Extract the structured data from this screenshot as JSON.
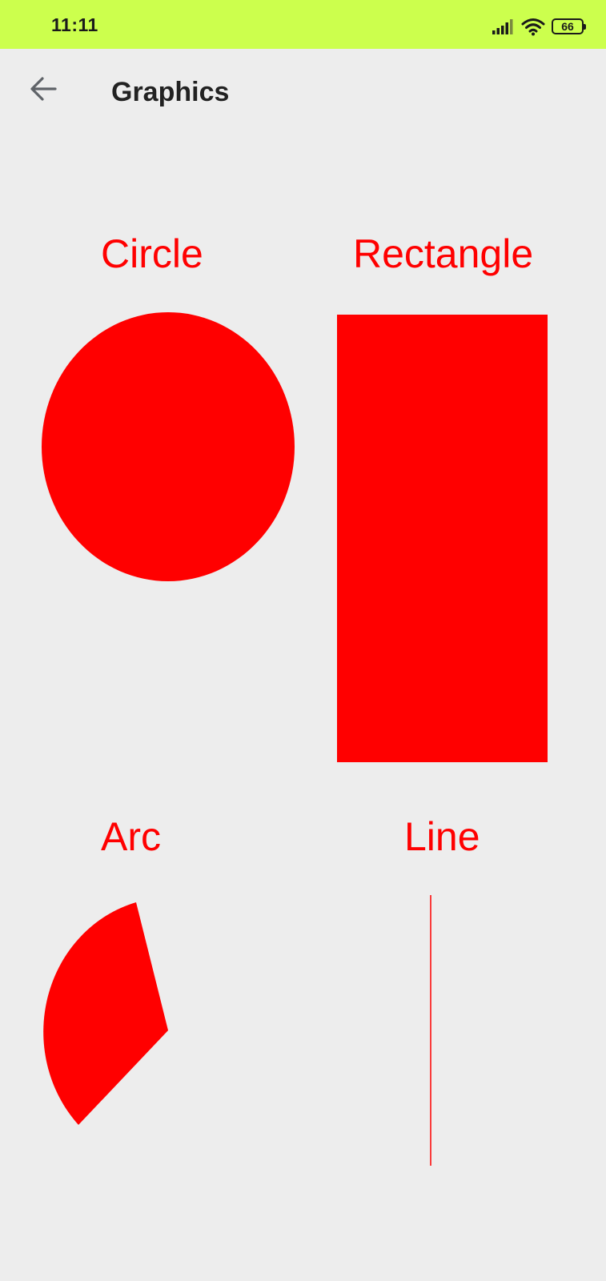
{
  "status_bar": {
    "time": "11:11",
    "signal_icon": "cellular-signal-icon",
    "wifi_icon": "wifi-icon",
    "battery_level": "66",
    "background_color": "#ccff4d"
  },
  "app_bar": {
    "back_icon": "arrow-back-icon",
    "title": "Graphics"
  },
  "content": {
    "shape_color": "#ff0000",
    "shapes": [
      {
        "label": "Circle",
        "kind": "circle"
      },
      {
        "label": "Rectangle",
        "kind": "rectangle"
      },
      {
        "label": "Arc",
        "kind": "arc"
      },
      {
        "label": "Line",
        "kind": "line"
      }
    ]
  }
}
